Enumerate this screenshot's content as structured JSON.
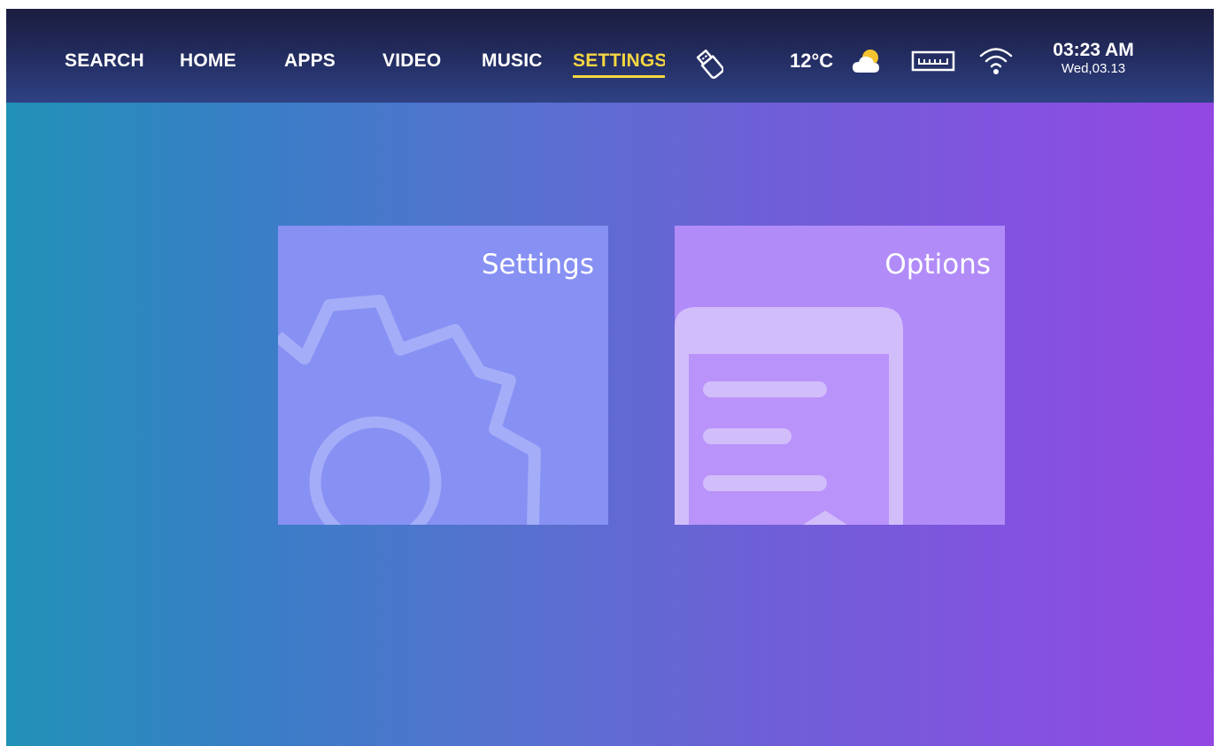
{
  "nav": {
    "items": [
      {
        "label": "SEARCH"
      },
      {
        "label": "HOME"
      },
      {
        "label": "APPS"
      },
      {
        "label": "VIDEO"
      },
      {
        "label": "MUSIC"
      },
      {
        "label": "SETTINGS",
        "active": true
      }
    ],
    "active_color": "#f5d742"
  },
  "status": {
    "usb_icon": "usb-drive-icon",
    "temperature": "12°C",
    "weather_icon": "partly-cloudy-icon",
    "ethernet_icon": "ethernet-port-icon",
    "wifi_icon": "wifi-icon",
    "time": "03:23 AM",
    "date": "Wed,03.13"
  },
  "tiles": [
    {
      "title": "Settings",
      "icon": "gear-icon",
      "color": "#8790f3"
    },
    {
      "title": "Options",
      "icon": "phone-document-icon",
      "color": "#b18cf8"
    }
  ]
}
